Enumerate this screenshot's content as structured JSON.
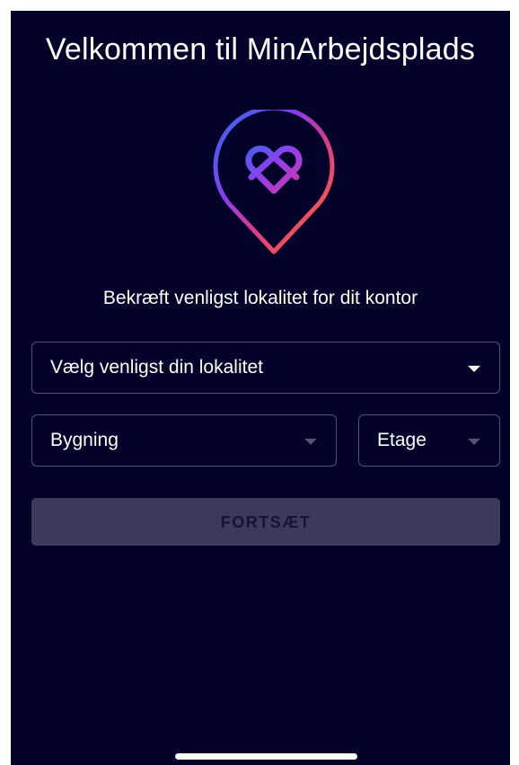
{
  "header": {
    "title": "Velkommen til MinArbejdsplads"
  },
  "logo": {
    "icon": "location-pin-heart-icon",
    "gradient_colors": [
      "#2f6df0",
      "#8a3cf0",
      "#e23a8a",
      "#f0505a",
      "#4fe0a0",
      "#3ad0c0"
    ]
  },
  "main": {
    "subtitle": "Bekræft venligst lokalitet for dit kontor",
    "location_select": {
      "value": "Vælg venligst din lokalitet",
      "icon": "caret-down-icon"
    },
    "building_select": {
      "value": "Bygning",
      "icon": "caret-down-icon",
      "enabled": false
    },
    "floor_select": {
      "value": "Etage",
      "icon": "caret-down-icon",
      "enabled": false
    },
    "continue_button": {
      "label": "FORTSÆT",
      "enabled": false
    }
  },
  "colors": {
    "background": "#03022b",
    "text": "#ffffff",
    "button_disabled_bg": "#3b3a5b",
    "button_disabled_text": "#151437"
  }
}
